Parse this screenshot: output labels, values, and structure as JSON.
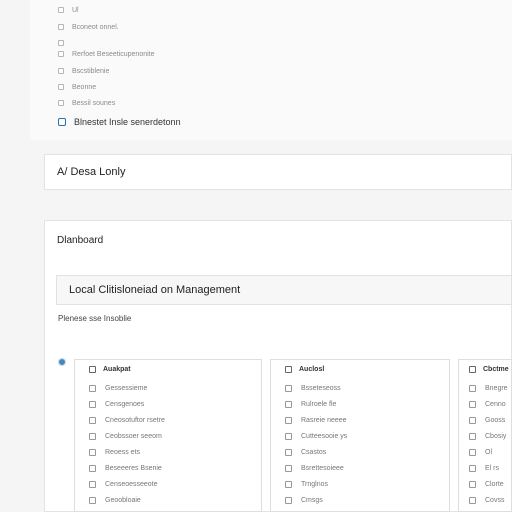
{
  "top_checklist": [
    {
      "label": "Ul"
    },
    {
      "label": "Bconeot onnel."
    },
    {
      "label": ""
    },
    {
      "label": "Rerfoet Beseeticupenonite"
    },
    {
      "label": "Bscstiblenie"
    },
    {
      "label": "Beonne"
    },
    {
      "label": "Bessil sounes"
    },
    {
      "label": "Blnestet Insle senerdetonn"
    }
  ],
  "sections": {
    "activity": {
      "title": "A/ Desa Lonly"
    },
    "dashboard": {
      "title": "Dlanboard"
    },
    "management": {
      "title": "Local Clitisloneiad on Management"
    }
  },
  "helper_text": "Plenese sse Insoblie",
  "panels": [
    {
      "title": "Auakpat",
      "items": [
        "Gessessieme",
        "Censgenoes",
        "Cneosotuftor   rsetre",
        "Ceobssoer seeom",
        "Reoess      ets",
        "Beseeeres Bsenie",
        "Censeoesseeote",
        "Geoobloaie"
      ]
    },
    {
      "title": "Auclosl",
      "items": [
        "Bsseteseoss",
        "Rulroele fle",
        "Rasreie      neeee",
        "Cutteesooie ys",
        "Csastos",
        "Bsrettesoieee",
        "Trnglnos",
        "Cmsgs"
      ]
    },
    {
      "title": "Cbctme",
      "items": [
        "Bnegre",
        "Cenno",
        "Gooss",
        "Cbosiy",
        "Ol",
        "El rs",
        "Clorte",
        "Covss"
      ]
    }
  ]
}
